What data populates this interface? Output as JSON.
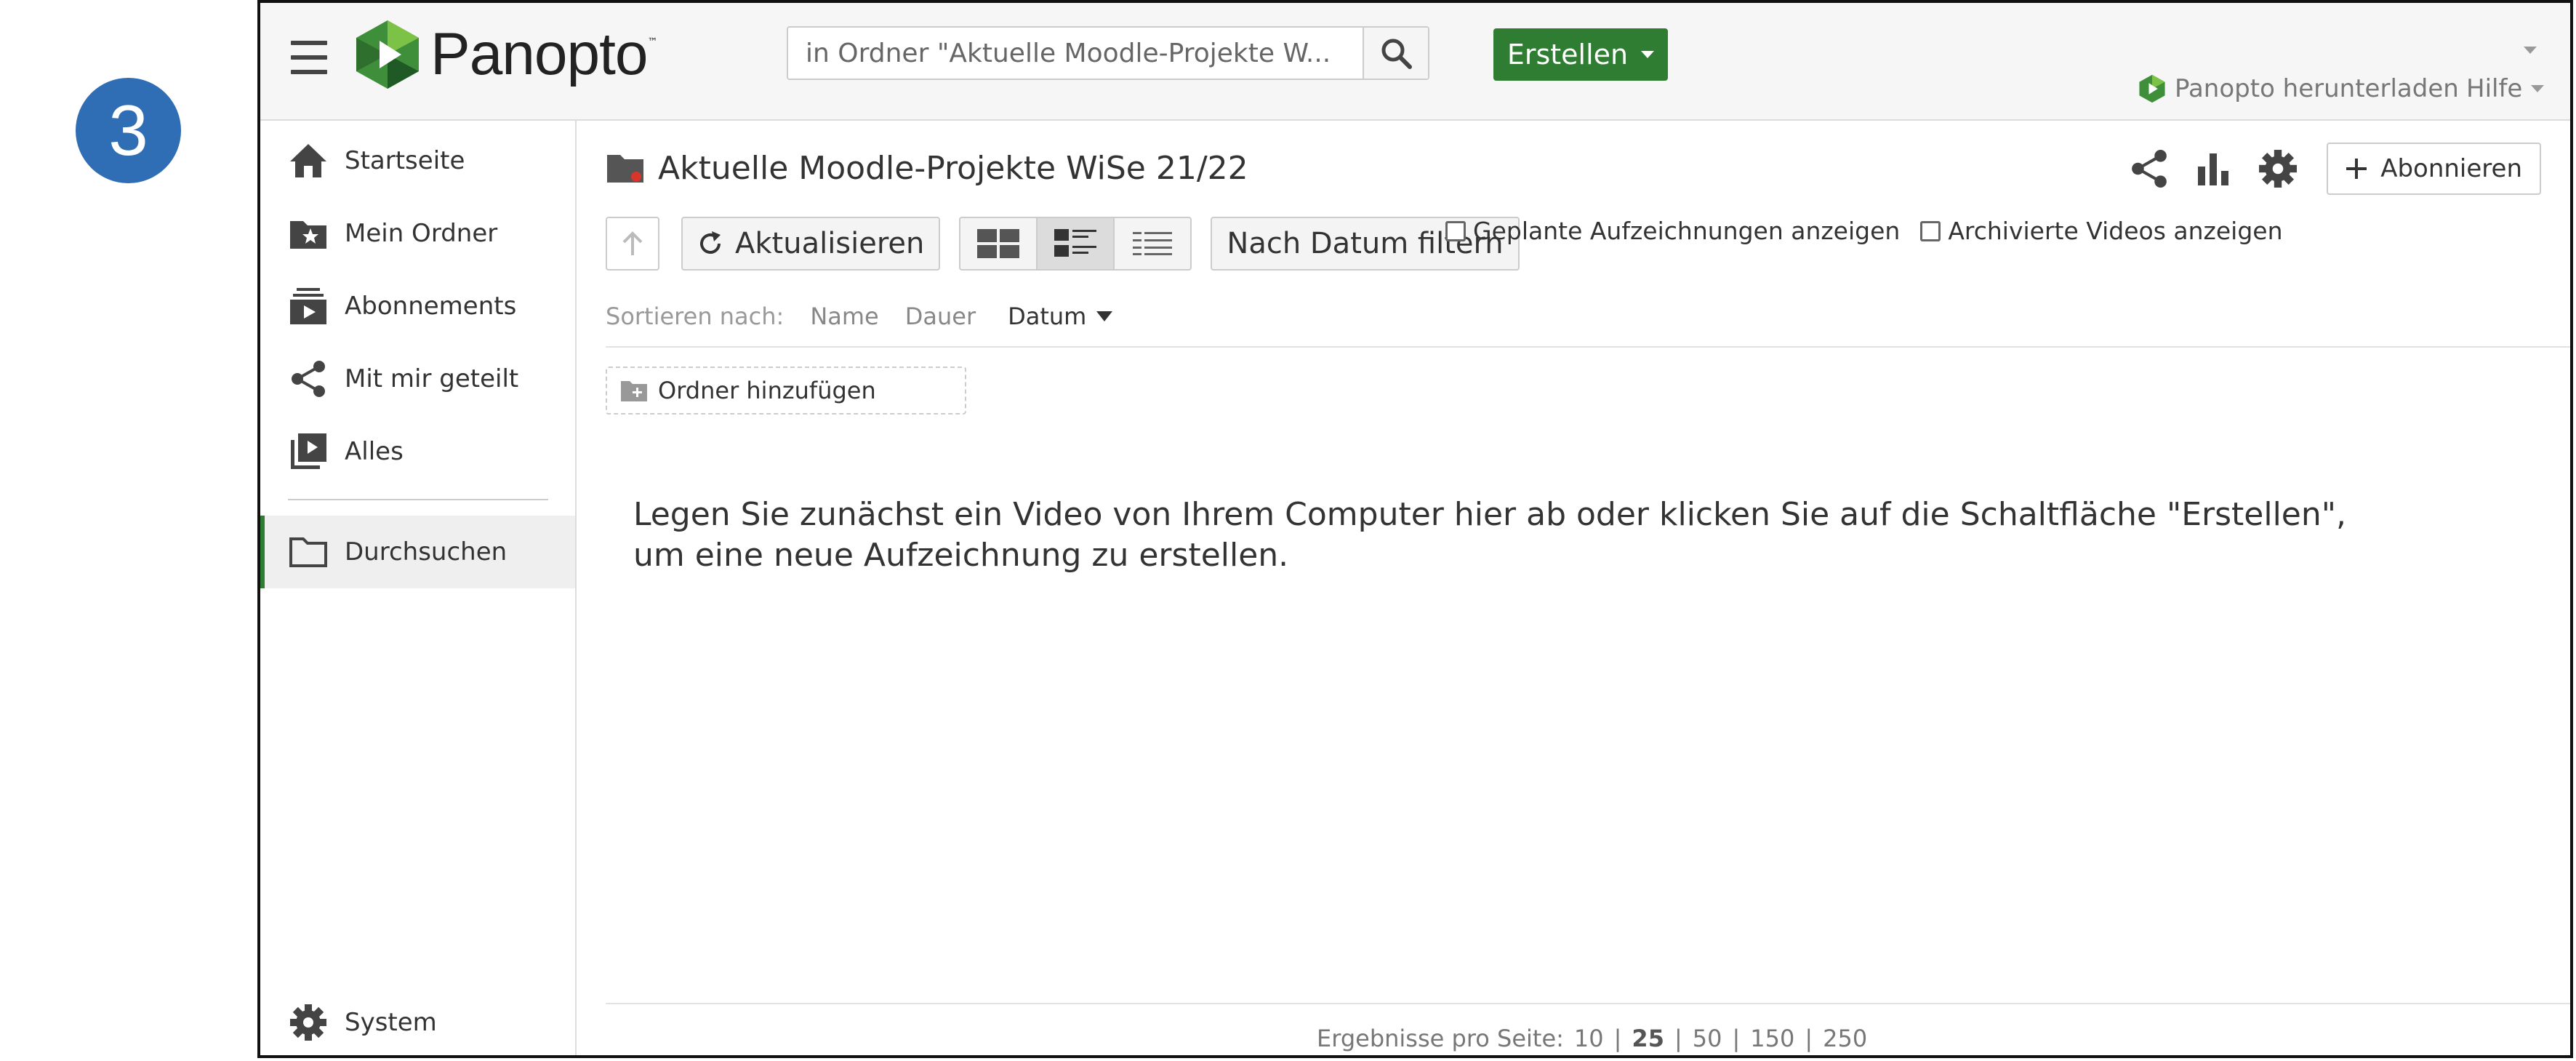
{
  "step_number": "3",
  "header": {
    "app_name": "Panopto",
    "trademark": "™",
    "search_placeholder": "in Ordner \"Aktuelle Moodle-Projekte W...",
    "create_label": "Erstellen",
    "download_label": "Panopto herunterladen",
    "help_label": "Hilfe"
  },
  "sidebar": {
    "items": [
      {
        "label": "Startseite",
        "icon": "home-icon"
      },
      {
        "label": "Mein Ordner",
        "icon": "starred-folder-icon"
      },
      {
        "label": "Abonnements",
        "icon": "subscriptions-icon"
      },
      {
        "label": "Mit mir geteilt",
        "icon": "share-icon"
      },
      {
        "label": "Alles",
        "icon": "video-library-icon"
      }
    ],
    "browse_label": "Durchsuchen",
    "system_label": "System"
  },
  "main": {
    "folder_title": "Aktuelle Moodle-Projekte WiSe 21/22",
    "subscribe_label": "Abonnieren",
    "refresh_label": "Aktualisieren",
    "date_filter_label": "Nach Datum filtern",
    "show_scheduled_label": "Geplante Aufzeichnungen anzeigen",
    "show_archived_label": "Archivierte Videos anzeigen",
    "sort": {
      "label": "Sortieren nach:",
      "name": "Name",
      "duration": "Dauer",
      "date": "Datum"
    },
    "add_folder_label": "Ordner hinzufügen",
    "empty_message": "Legen Sie zunächst ein Video von Ihrem Computer hier ab oder klicken Sie auf die Schaltfläche \"Erstellen\", um eine neue Aufzeichnung zu erstellen.",
    "pagination": {
      "label": "Ergebnisse pro Seite:",
      "options": [
        "10",
        "25",
        "50",
        "150",
        "250"
      ],
      "selected": "25"
    }
  },
  "colors": {
    "accent_green": "#2f7d32",
    "badge_blue": "#2f6db5",
    "folder_red_dot": "#d9362b"
  }
}
